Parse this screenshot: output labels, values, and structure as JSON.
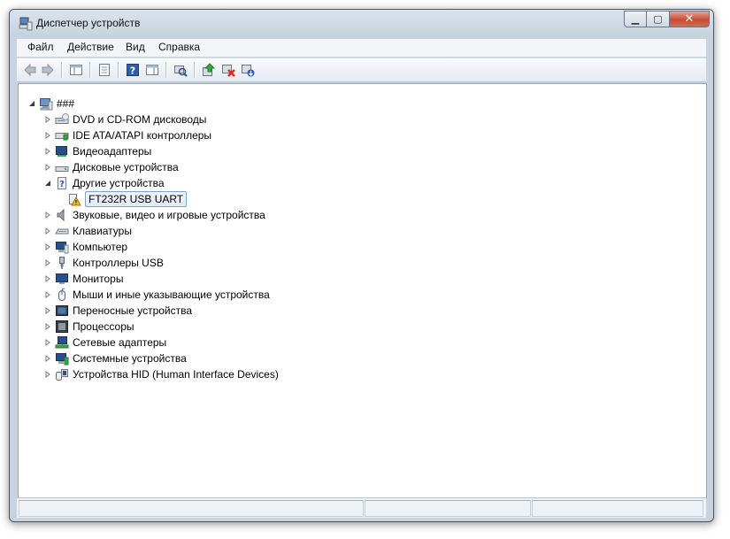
{
  "window": {
    "title": "Диспетчер устройств",
    "caption_buttons": {
      "minimize_icon": "minimize-icon",
      "maximize_icon": "maximize-icon",
      "close_icon": "close-icon"
    }
  },
  "menu": [
    "Файл",
    "Действие",
    "Вид",
    "Справка"
  ],
  "toolbar_icons": [
    "back-arrow-icon",
    "forward-arrow-icon",
    "show-hide-console-tree-icon",
    "properties-icon",
    "help-icon",
    "action-pane-icon",
    "scan-hardware-changes-icon",
    "update-driver-icon",
    "disable-device-icon",
    "uninstall-device-icon"
  ],
  "tree": {
    "root": {
      "label": "###",
      "icon": "computer-icon",
      "expanded": true
    },
    "items": [
      {
        "label": "DVD и CD-ROM дисководы",
        "icon": "dvd-drive-icon",
        "expanded": false
      },
      {
        "label": "IDE ATA/ATAPI контроллеры",
        "icon": "ide-controller-icon",
        "expanded": false
      },
      {
        "label": "Видеоадаптеры",
        "icon": "display-adapter-icon",
        "expanded": false
      },
      {
        "label": "Дисковые устройства",
        "icon": "disk-drive-icon",
        "expanded": false
      },
      {
        "label": "Другие устройства",
        "icon": "unknown-device-icon",
        "expanded": true,
        "children": [
          {
            "label": "FT232R USB UART",
            "icon": "warning-device-icon",
            "selected": true
          }
        ]
      },
      {
        "label": "Звуковые, видео и игровые устройства",
        "icon": "speaker-icon",
        "expanded": false
      },
      {
        "label": "Клавиатуры",
        "icon": "keyboard-icon",
        "expanded": false
      },
      {
        "label": "Компьютер",
        "icon": "computer-monitor-icon",
        "expanded": false
      },
      {
        "label": "Контроллеры USB",
        "icon": "usb-plug-icon",
        "expanded": false
      },
      {
        "label": "Мониторы",
        "icon": "monitor-icon",
        "expanded": false
      },
      {
        "label": "Мыши и иные указывающие устройства",
        "icon": "mouse-icon",
        "expanded": false
      },
      {
        "label": "Переносные устройства",
        "icon": "portable-device-icon",
        "expanded": false
      },
      {
        "label": "Процессоры",
        "icon": "processor-icon",
        "expanded": false
      },
      {
        "label": "Сетевые адаптеры",
        "icon": "network-adapter-icon",
        "expanded": false
      },
      {
        "label": "Системные устройства",
        "icon": "system-device-icon",
        "expanded": false
      },
      {
        "label": "Устройства HID (Human Interface Devices)",
        "icon": "hid-device-icon",
        "expanded": false
      }
    ]
  },
  "colors": {
    "selection_border": "#7da2ce",
    "close_button": "#c74b35",
    "warning": "#f2c200"
  }
}
